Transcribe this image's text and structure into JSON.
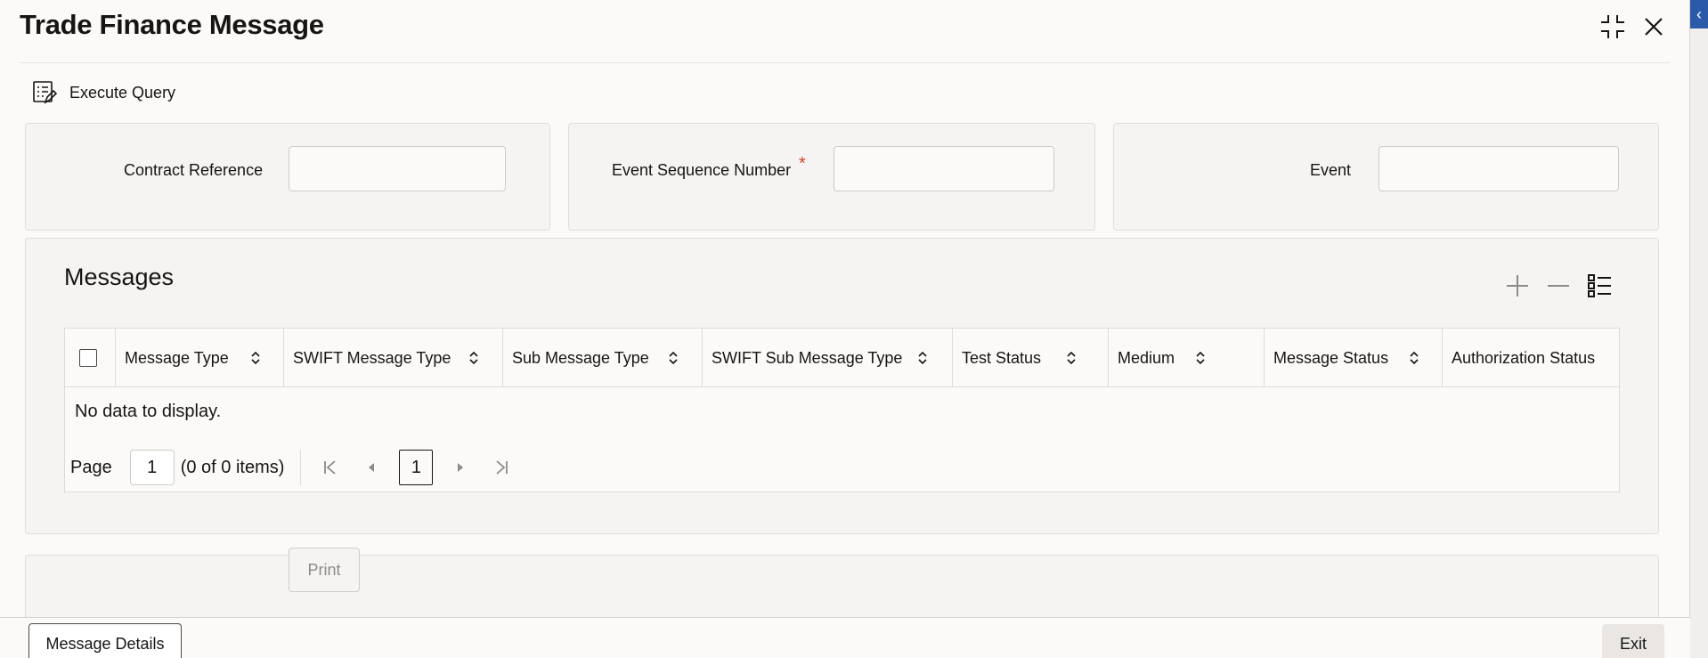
{
  "window": {
    "title": "Trade Finance Message"
  },
  "toolbar": {
    "execute_query_label": "Execute Query"
  },
  "query_fields": {
    "contract_reference": {
      "label": "Contract Reference",
      "value": ""
    },
    "event_sequence_number": {
      "label": "Event Sequence Number",
      "required_marker": "*",
      "value": ""
    },
    "event": {
      "label": "Event",
      "value": ""
    }
  },
  "messages": {
    "title": "Messages",
    "columns": [
      "Message Type",
      "SWIFT Message Type",
      "Sub Message Type",
      "SWIFT Sub Message Type",
      "Test Status",
      "Medium",
      "Message Status",
      "Authorization Status"
    ],
    "rows": [],
    "empty_text": "No data to display.",
    "pager": {
      "page_label": "Page",
      "page_value": "1",
      "items_text": "(0 of 0 items)",
      "current_page": "1"
    }
  },
  "actions": {
    "print_label": "Print"
  },
  "footer": {
    "message_details_label": "Message Details",
    "exit_label": "Exit"
  },
  "colors": {
    "required": "#c74634",
    "accent_strip": "#2a5aa8"
  }
}
